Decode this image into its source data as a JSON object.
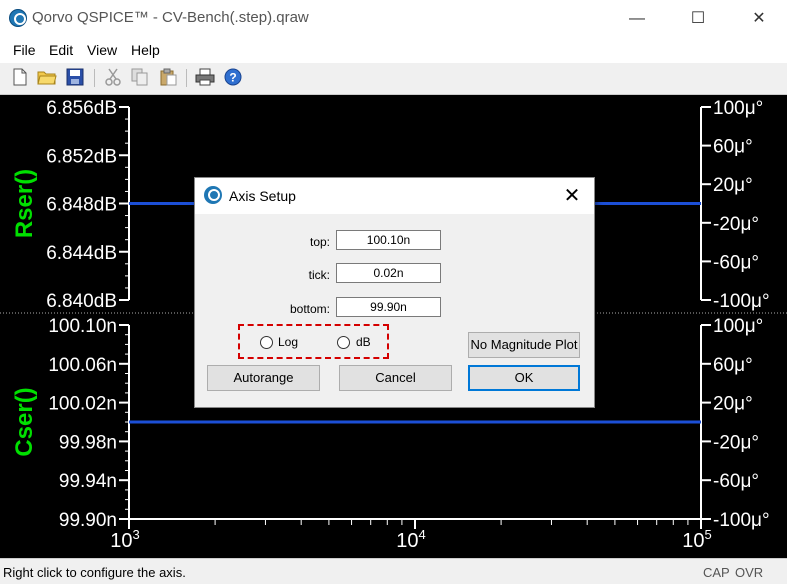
{
  "window": {
    "title": "Qorvo QSPICE™ - CV-Bench(.step).qraw",
    "minimize": "—",
    "maximize": "☐",
    "close": "✕"
  },
  "menu": [
    "File",
    "Edit",
    "View",
    "Help"
  ],
  "toolbar": {
    "icons": [
      "new-file-icon",
      "open-folder-icon",
      "save-icon",
      "cut-icon",
      "copy-icon",
      "paste-icon",
      "print-icon",
      "help-icon"
    ]
  },
  "plot": {
    "colors": {
      "background": "#000000",
      "trace_label": "#00e000",
      "trace": "#1c4fd6",
      "axis": "#ffffff",
      "grid": "#ffffff"
    },
    "x_axis": {
      "scale": "log",
      "ticks": [
        {
          "base": "10",
          "exp": "3"
        },
        {
          "base": "10",
          "exp": "4"
        },
        {
          "base": "10",
          "exp": "5"
        }
      ]
    },
    "panes": [
      {
        "trace_name": "Rser()",
        "left_ticks": [
          "6.856dB",
          "6.852dB",
          "6.848dB",
          "6.844dB",
          "6.840dB"
        ],
        "right_ticks": [
          "100μ°",
          "60μ°",
          "20μ°",
          "-20μ°",
          "-60μ°",
          "-100μ°"
        ]
      },
      {
        "trace_name": "Cser()",
        "left_ticks": [
          "100.10n",
          "100.06n",
          "100.02n",
          "99.98n",
          "99.94n",
          "99.90n"
        ],
        "right_ticks": [
          "100μ°",
          "60μ°",
          "20μ°",
          "-20μ°",
          "-60μ°",
          "-100μ°"
        ]
      }
    ]
  },
  "chart_data": [
    {
      "type": "line",
      "title": "",
      "ylabel": "Rser()",
      "x_scale": "log",
      "xlim": [
        1000,
        100000
      ],
      "ylim": [
        6.84,
        6.856
      ],
      "y_unit": "dB",
      "y2lim": [
        -100,
        100
      ],
      "y2_unit": "μ°",
      "series": [
        {
          "name": "Rser()",
          "style": "solid",
          "x": [
            1000,
            100000
          ],
          "values": [
            6.848,
            6.848
          ]
        },
        {
          "name": "Rser()",
          "style": "dotted",
          "x": [
            1000,
            100000
          ],
          "values": [
            0,
            0
          ]
        }
      ]
    },
    {
      "type": "line",
      "title": "",
      "ylabel": "Cser()",
      "x_scale": "log",
      "xlim": [
        1000,
        100000
      ],
      "ylim": [
        99.9,
        100.1
      ],
      "y_unit": "n",
      "y2lim": [
        -100,
        100
      ],
      "y2_unit": "μ°",
      "series": [
        {
          "name": "Cser()",
          "style": "solid",
          "x": [
            1000,
            100000
          ],
          "values": [
            100.0,
            100.0
          ]
        }
      ]
    }
  ],
  "dialog": {
    "title": "Axis Setup",
    "close": "✕",
    "top_label": "top:",
    "top_value": "100.10n",
    "tick_label": "tick:",
    "tick_value": "0.02n",
    "bottom_label": "bottom:",
    "bottom_value": "99.90n",
    "log_label": "Log",
    "db_label": "dB",
    "no_mag_label": "No Magnitude Plot",
    "autorange_label": "Autorange",
    "cancel_label": "Cancel",
    "ok_label": "OK"
  },
  "status": {
    "text": "Right click to configure the  axis.",
    "cap": "CAP",
    "ovr": "OVR"
  }
}
